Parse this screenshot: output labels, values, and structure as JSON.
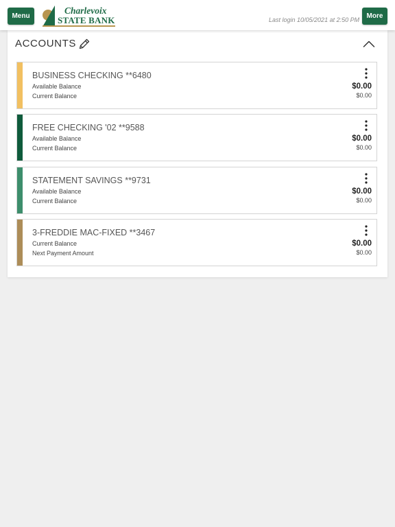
{
  "header": {
    "menu_label": "Menu",
    "more_label": "More",
    "logo_line1": "Charlevoix",
    "logo_line2": "STATE BANK",
    "last_login": "Last login 10/05/2021 at 2:50 PM"
  },
  "accounts_panel": {
    "title": "ACCOUNTS",
    "accounts": [
      {
        "name": "BUSINESS CHECKING **6480",
        "label1": "Available Balance",
        "value1": "$0.00",
        "label2": "Current Balance",
        "value2": "$0.00",
        "stripe_color": "#f2c061"
      },
      {
        "name": "FREE CHECKING '02 **9588",
        "label1": "Available Balance",
        "value1": "$0.00",
        "label2": "Current Balance",
        "value2": "$0.00",
        "stripe_color": "#0f5b3c"
      },
      {
        "name": "STATEMENT SAVINGS **9731",
        "label1": "Available Balance",
        "value1": "$0.00",
        "label2": "Current Balance",
        "value2": "$0.00",
        "stripe_color": "#3d8e6c"
      },
      {
        "name": "3-FREDDIE MAC-FIXED **3467",
        "label1": "Current Balance",
        "value1": "$0.00",
        "label2": "Next Payment Amount",
        "value2": "$0.00",
        "stripe_color": "#ad8d58"
      }
    ]
  },
  "colors": {
    "brand_green": "#1f6b47",
    "brand_gold": "#b8954f",
    "page_background": "#efefef"
  },
  "icons": {
    "edit": "pencil-icon",
    "collapse": "chevron-up-icon",
    "account_menu": "more-vertical-icon"
  }
}
